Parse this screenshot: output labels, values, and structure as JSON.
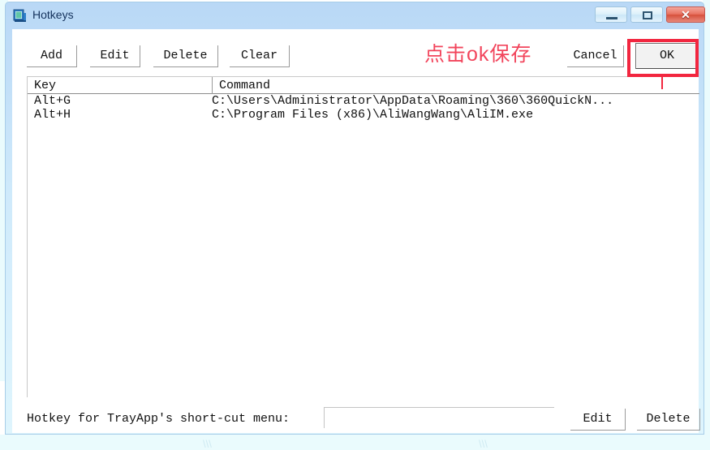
{
  "window": {
    "title": "Hotkeys",
    "icon": "app-window-icon",
    "controls": {
      "minimize": "minimize-icon",
      "maximize": "maximize-icon",
      "close": "✕"
    }
  },
  "toolbar": {
    "add_label": "Add",
    "edit_label": "Edit",
    "delete_label": "Delete",
    "clear_label": "Clear",
    "cancel_label": "Cancel",
    "ok_label": "OK"
  },
  "list": {
    "columns": [
      "Key",
      "Command"
    ],
    "rows": [
      {
        "key": "Alt+G",
        "command": "C:\\Users\\Administrator\\AppData\\Roaming\\360\\360QuickN..."
      },
      {
        "key": "Alt+H",
        "command": "C:\\Program Files (x86)\\AliWangWang\\AliIM.exe"
      }
    ]
  },
  "bottom": {
    "label": "Hotkey for TrayApp's short-cut menu:",
    "hotkey_value": "",
    "hotkey_placeholder": "",
    "edit_label": "Edit",
    "delete_label": "Delete"
  },
  "annotation": {
    "text": "点击ok保存",
    "color": "#f2263f",
    "highlight_target": "OK"
  },
  "colors": {
    "title_gradient_start": "#b9d8f6",
    "title_gradient_end": "#dff5fd",
    "close_button": "#d6503c",
    "annotation_red": "#f2263f",
    "desktop_wash": "#d9f7fb"
  }
}
